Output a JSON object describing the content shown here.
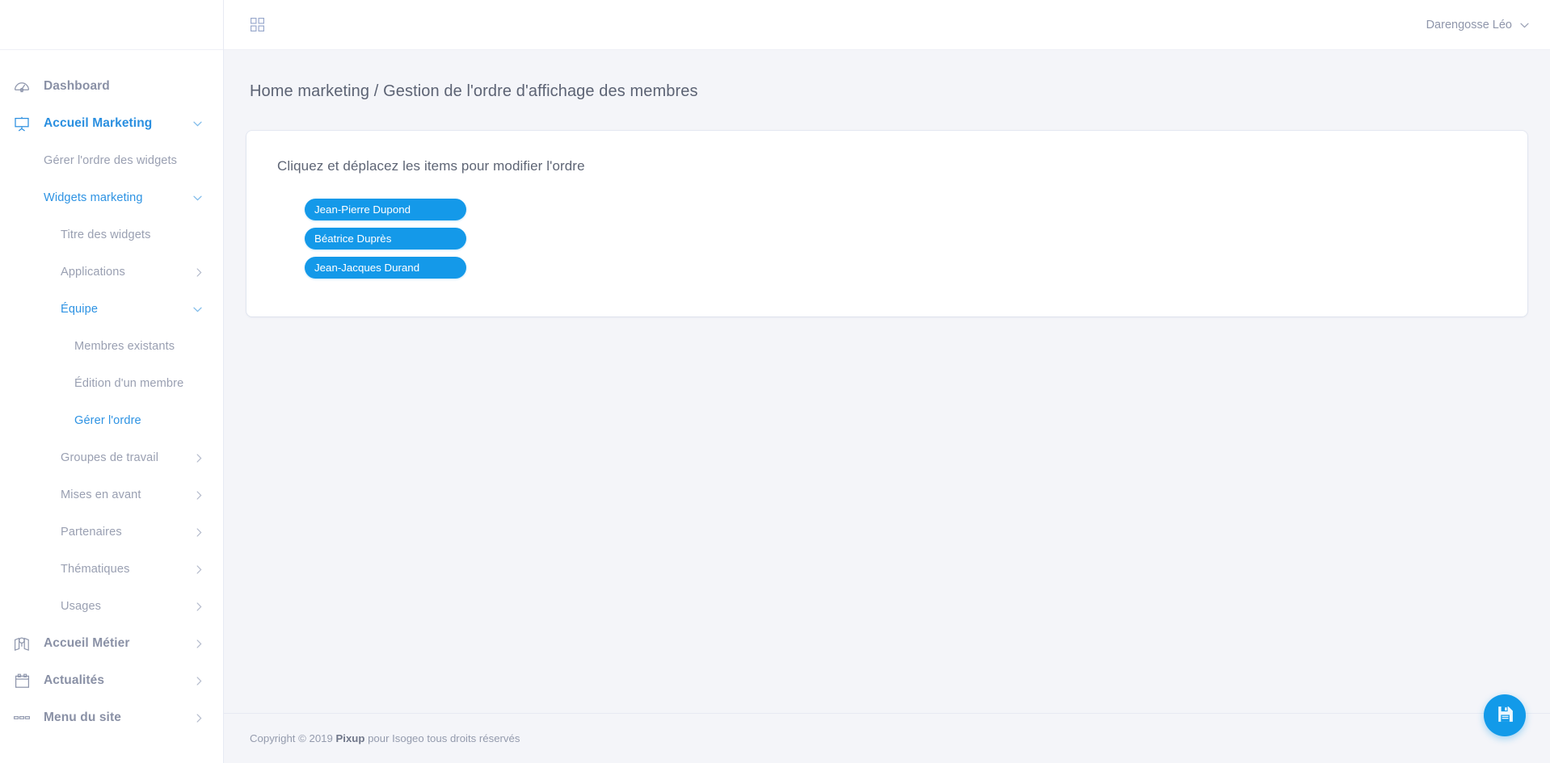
{
  "topbar": {
    "grid_icon": "grid-apps-icon",
    "user_name": "Darengosse Léo",
    "user_chevron": "chevron-down-icon"
  },
  "breadcrumb": {
    "text": "Home marketing / Gestion de l'ordre d'affichage des membres"
  },
  "card": {
    "title": "Cliquez et déplacez les items pour modifier l'ordre",
    "items": [
      {
        "label": "Jean-Pierre Dupond"
      },
      {
        "label": "Béatrice Duprès"
      },
      {
        "label": "Jean-Jacques Durand"
      }
    ]
  },
  "footer": {
    "prefix": "Copyright © 2019 ",
    "brand": "Pixup",
    "suffix": " pour Isogeo tous droits réservés",
    "save_button": "save-floppy-icon"
  },
  "sidebar": {
    "items": [
      {
        "label": "Dashboard",
        "icon": "gauge-icon",
        "level": 0,
        "state": "default",
        "chevron": "none"
      },
      {
        "label": "Accueil Marketing",
        "icon": "presentation-icon",
        "level": 0,
        "state": "active",
        "chevron": "down"
      },
      {
        "label": "Gérer l'ordre des widgets",
        "icon": "",
        "level": 1,
        "state": "default",
        "chevron": "none"
      },
      {
        "label": "Widgets marketing",
        "icon": "",
        "level": 1,
        "state": "active",
        "chevron": "down"
      },
      {
        "label": "Titre des widgets",
        "icon": "",
        "level": 2,
        "state": "default",
        "chevron": "none"
      },
      {
        "label": "Applications",
        "icon": "",
        "level": 2,
        "state": "default",
        "chevron": "right"
      },
      {
        "label": "Équipe",
        "icon": "",
        "level": 2,
        "state": "active",
        "chevron": "down"
      },
      {
        "label": "Membres existants",
        "icon": "",
        "level": 3,
        "state": "default",
        "chevron": "none"
      },
      {
        "label": "Édition d'un membre",
        "icon": "",
        "level": 3,
        "state": "default",
        "chevron": "none"
      },
      {
        "label": "Gérer l'ordre",
        "icon": "",
        "level": 3,
        "state": "active",
        "chevron": "none"
      },
      {
        "label": "Groupes de travail",
        "icon": "",
        "level": 2,
        "state": "default",
        "chevron": "right"
      },
      {
        "label": "Mises en avant",
        "icon": "",
        "level": 2,
        "state": "default",
        "chevron": "right"
      },
      {
        "label": "Partenaires",
        "icon": "",
        "level": 2,
        "state": "default",
        "chevron": "right"
      },
      {
        "label": "Thématiques",
        "icon": "",
        "level": 2,
        "state": "default",
        "chevron": "right"
      },
      {
        "label": "Usages",
        "icon": "",
        "level": 2,
        "state": "default",
        "chevron": "right"
      },
      {
        "label": "Accueil Métier",
        "icon": "map-pin-icon",
        "level": 0,
        "state": "default",
        "chevron": "right"
      },
      {
        "label": "Actualités",
        "icon": "calendar-icon",
        "level": 0,
        "state": "default",
        "chevron": "right"
      },
      {
        "label": "Menu du site",
        "icon": "menu-dashes-icon",
        "level": 0,
        "state": "default",
        "chevron": "right"
      }
    ]
  },
  "colors": {
    "accent_blue": "#1499e9",
    "link_blue": "#2e93e3",
    "page_background": "#f4f5f9",
    "panel_white": "#ffffff",
    "muted_text": "#9aa0b2"
  }
}
